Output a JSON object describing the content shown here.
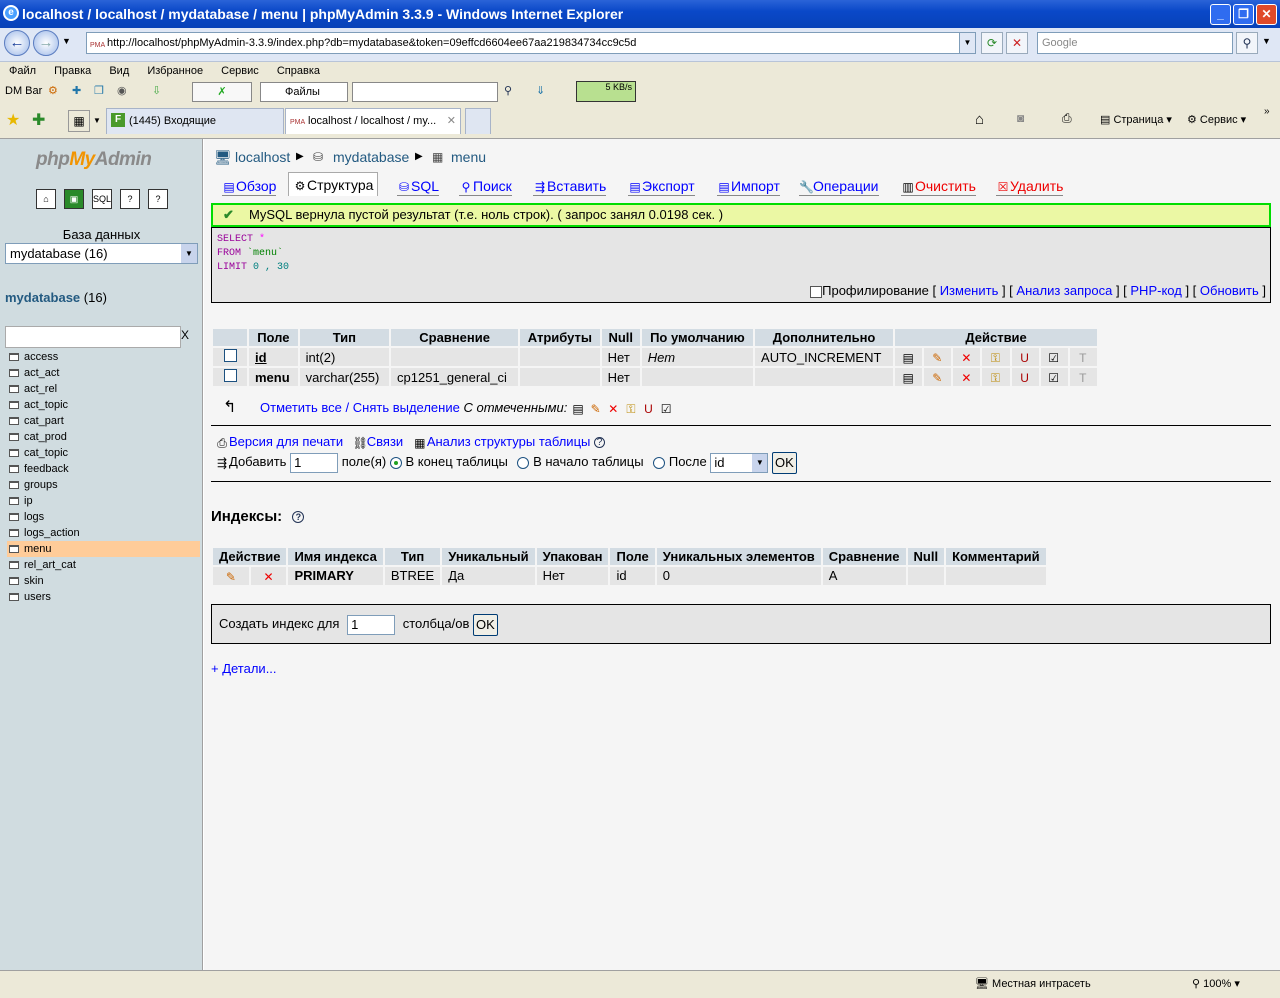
{
  "window": {
    "title": "localhost / localhost / mydatabase / menu | phpMyAdmin 3.3.9 - Windows Internet Explorer"
  },
  "address": {
    "url": "http://localhost/phpMyAdmin-3.3.9/index.php?db=mydatabase&token=09effcd6604ee67aa219834734cc9c5d",
    "favicon": "PMA",
    "search_placeholder": "Google"
  },
  "menubar": [
    "Файл",
    "Правка",
    "Вид",
    "Избранное",
    "Сервис",
    "Справка"
  ],
  "dmbar": {
    "label": "DM Bar",
    "files": "Файлы",
    "speed": "5 KB/s"
  },
  "tabs": [
    {
      "label": "(1445) Входящие"
    },
    {
      "label": "localhost / localhost / my..."
    }
  ],
  "ie_commands": {
    "page": "Страница",
    "tools": "Сервис"
  },
  "sidebar": {
    "logo_a": "php",
    "logo_b": "My",
    "logo_c": "Admin",
    "db_label": "База данных",
    "db_select": "mydatabase (16)",
    "db_name": "mydatabase",
    "db_count": "(16)",
    "filter_clear": "X",
    "tables": [
      "access",
      "act_act",
      "act_rel",
      "act_topic",
      "cat_part",
      "cat_prod",
      "cat_topic",
      "feedback",
      "groups",
      "ip",
      "logs",
      "logs_action",
      "menu",
      "rel_art_cat",
      "skin",
      "users"
    ],
    "selected": "menu"
  },
  "breadcrumb": {
    "server": "localhost",
    "db": "mydatabase",
    "table": "menu"
  },
  "page_tabs": [
    "Обзор",
    "Структура",
    "SQL",
    "Поиск",
    "Вставить",
    "Экспорт",
    "Импорт",
    "Операции",
    "Очистить",
    "Удалить"
  ],
  "message": "MySQL вернула пустой результат (т.е. ноль строк). ( запрос занял 0.0198 сек. )",
  "sql": {
    "line1a": "SELECT",
    "line1b": "*",
    "line2a": "FROM",
    "line2b": "`menu`",
    "line3a": "LIMIT",
    "line3b": "0 , 30"
  },
  "sql_links": {
    "profiling": "Профилирование",
    "edit": "Изменить",
    "explain": "Анализ запроса",
    "php": "PHP-код",
    "refresh": "Обновить"
  },
  "structure": {
    "headers": [
      "Поле",
      "Тип",
      "Сравнение",
      "Атрибуты",
      "Null",
      "По умолчанию",
      "Дополнительно",
      "Действие"
    ],
    "rows": [
      {
        "field": "id",
        "type": "int(2)",
        "collation": "",
        "attributes": "",
        "null": "Нет",
        "default": "Нет",
        "extra": "AUTO_INCREMENT"
      },
      {
        "field": "menu",
        "type": "varchar(255)",
        "collation": "cp1251_general_ci",
        "attributes": "",
        "null": "Нет",
        "default": "",
        "extra": ""
      }
    ],
    "check_all": "Отметить все",
    "uncheck": "Снять выделение",
    "with_selected": "С отмеченными:"
  },
  "links": {
    "print": "Версия для печати",
    "relations": "Связи",
    "analyze": "Анализ структуры таблицы"
  },
  "add_field": {
    "label": "Добавить",
    "count": "1",
    "fields": "поле(я)",
    "at_end": "В конец таблицы",
    "at_start": "В начало таблицы",
    "after": "После",
    "after_value": "id",
    "ok": "OK"
  },
  "indexes": {
    "title": "Индексы:",
    "headers": [
      "Действие",
      "Имя индекса",
      "Тип",
      "Уникальный",
      "Упакован",
      "Поле",
      "Уникальных элементов",
      "Сравнение",
      "Null",
      "Комментарий"
    ],
    "rows": [
      {
        "name": "PRIMARY",
        "type": "BTREE",
        "unique": "Да",
        "packed": "Нет",
        "field": "id",
        "cardinality": "0",
        "collation": "A",
        "null": "",
        "comment": ""
      }
    ],
    "create_label": "Создать индекс для",
    "create_count": "1",
    "create_cols": "столбца/ов",
    "ok": "OK",
    "details": "+ Детали..."
  },
  "status": {
    "zone": "Местная интрасеть",
    "zoom": "100%"
  }
}
